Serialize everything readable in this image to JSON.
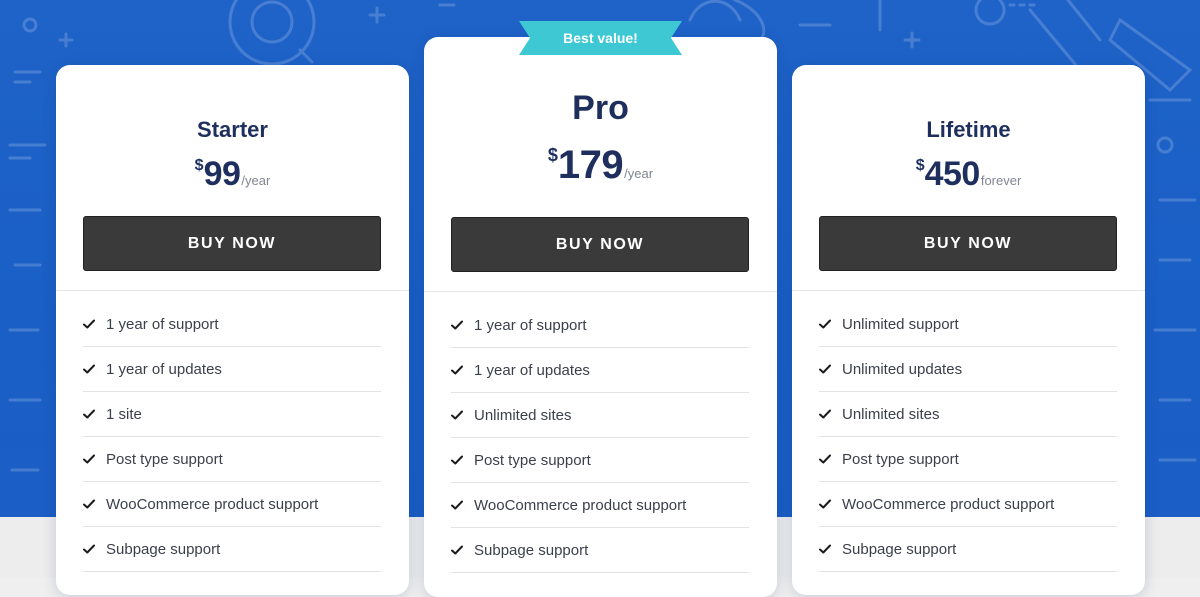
{
  "colors": {
    "background_blue": "#1f63c8",
    "card_background": "#ffffff",
    "plan_title": "#1e2f5e",
    "button_background": "#3a3a3a",
    "ribbon": "#3ec8d4",
    "feature_text": "#3b3f4a"
  },
  "ribbon": {
    "label": "Best value!"
  },
  "plans": [
    {
      "name": "Starter",
      "currency": "$",
      "amount": "99",
      "period": "/year",
      "button_label": "BUY NOW",
      "features": [
        "1 year of support",
        "1 year of updates",
        "1 site",
        "Post type support",
        "WooCommerce product support",
        "Subpage support"
      ]
    },
    {
      "name": "Pro",
      "currency": "$",
      "amount": "179",
      "period": "/year",
      "button_label": "BUY NOW",
      "features": [
        "1 year of support",
        "1 year of updates",
        "Unlimited sites",
        "Post type support",
        "WooCommerce product support",
        "Subpage support"
      ]
    },
    {
      "name": "Lifetime",
      "currency": "$",
      "amount": "450",
      "period": "forever",
      "button_label": "BUY NOW",
      "features": [
        "Unlimited support",
        "Unlimited updates",
        "Unlimited sites",
        "Post type support",
        "WooCommerce product support",
        "Subpage support"
      ]
    }
  ],
  "icons": {
    "feature_check": "check-icon",
    "background_pattern": "doodle-pattern"
  }
}
